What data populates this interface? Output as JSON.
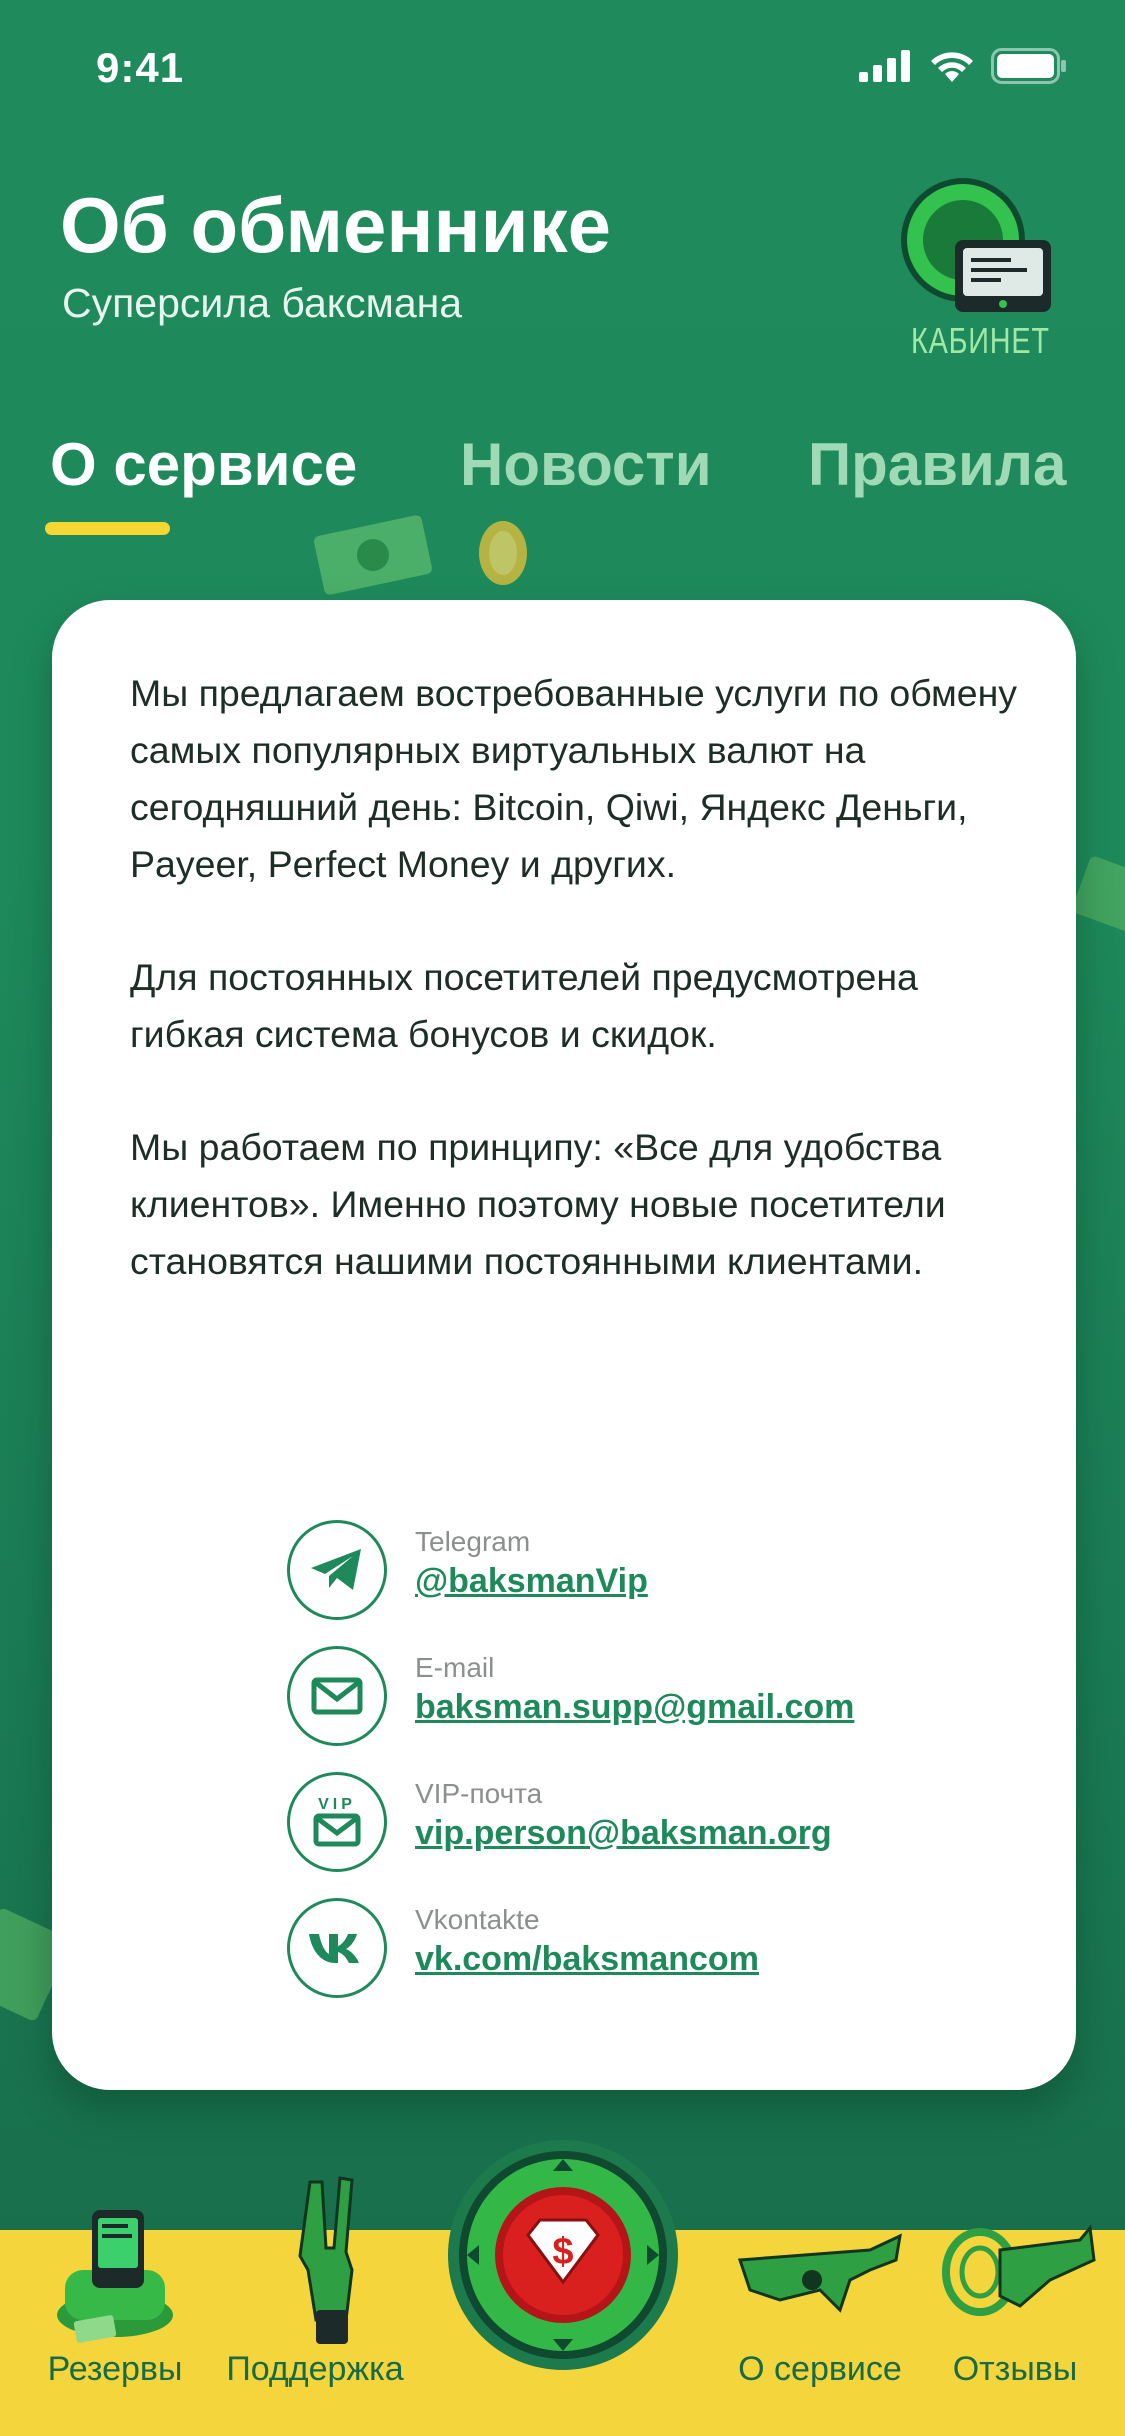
{
  "status": {
    "time": "9:41"
  },
  "header": {
    "title": "Об обменнике",
    "subtitle": "Суперсила баксмана",
    "cabinet_label": "КАБИНЕТ"
  },
  "tabs": [
    {
      "label": "О сервисе",
      "active": true
    },
    {
      "label": "Новости",
      "active": false
    },
    {
      "label": "Правила",
      "active": false
    }
  ],
  "about": {
    "paragraphs": [
      "Мы предлагаем востребованные услуги по обмену самых популярных виртуальных валют на сегодняшний день: Bitcoin, Qiwi, Яндекс Деньги, Payeer, Perfect Money и других.",
      "Для постоянных посетителей предусмотрена гибкая система бонусов и скидок.",
      "Мы работаем по принципу: «Все для удобства клиентов». Именно поэтому новые посетители становятся нашими постоянными клиентами."
    ]
  },
  "contacts": [
    {
      "label": "Telegram",
      "value": "@baksmanVip",
      "icon": "telegram-icon"
    },
    {
      "label": "E-mail",
      "value": "baksman.supp@gmail.com",
      "icon": "mail-icon"
    },
    {
      "label": "VIP-почта",
      "value": "vip.person@baksman.org",
      "icon": "vip-mail-icon",
      "icon_text": "VIP"
    },
    {
      "label": "Vkontakte",
      "value": "vk.com/baksmancom",
      "icon": "vk-icon"
    }
  ],
  "nav": {
    "items": [
      {
        "label": "Резервы",
        "icon": "reserves-icon"
      },
      {
        "label": "Поддержка",
        "icon": "support-icon"
      },
      {
        "label": "О сервисе",
        "icon": "about-icon"
      },
      {
        "label": "Отзывы",
        "icon": "reviews-icon"
      }
    ]
  },
  "colors": {
    "brand_green": "#1e8a5b",
    "accent_yellow": "#f4d53c",
    "home_red": "#d9201f"
  }
}
